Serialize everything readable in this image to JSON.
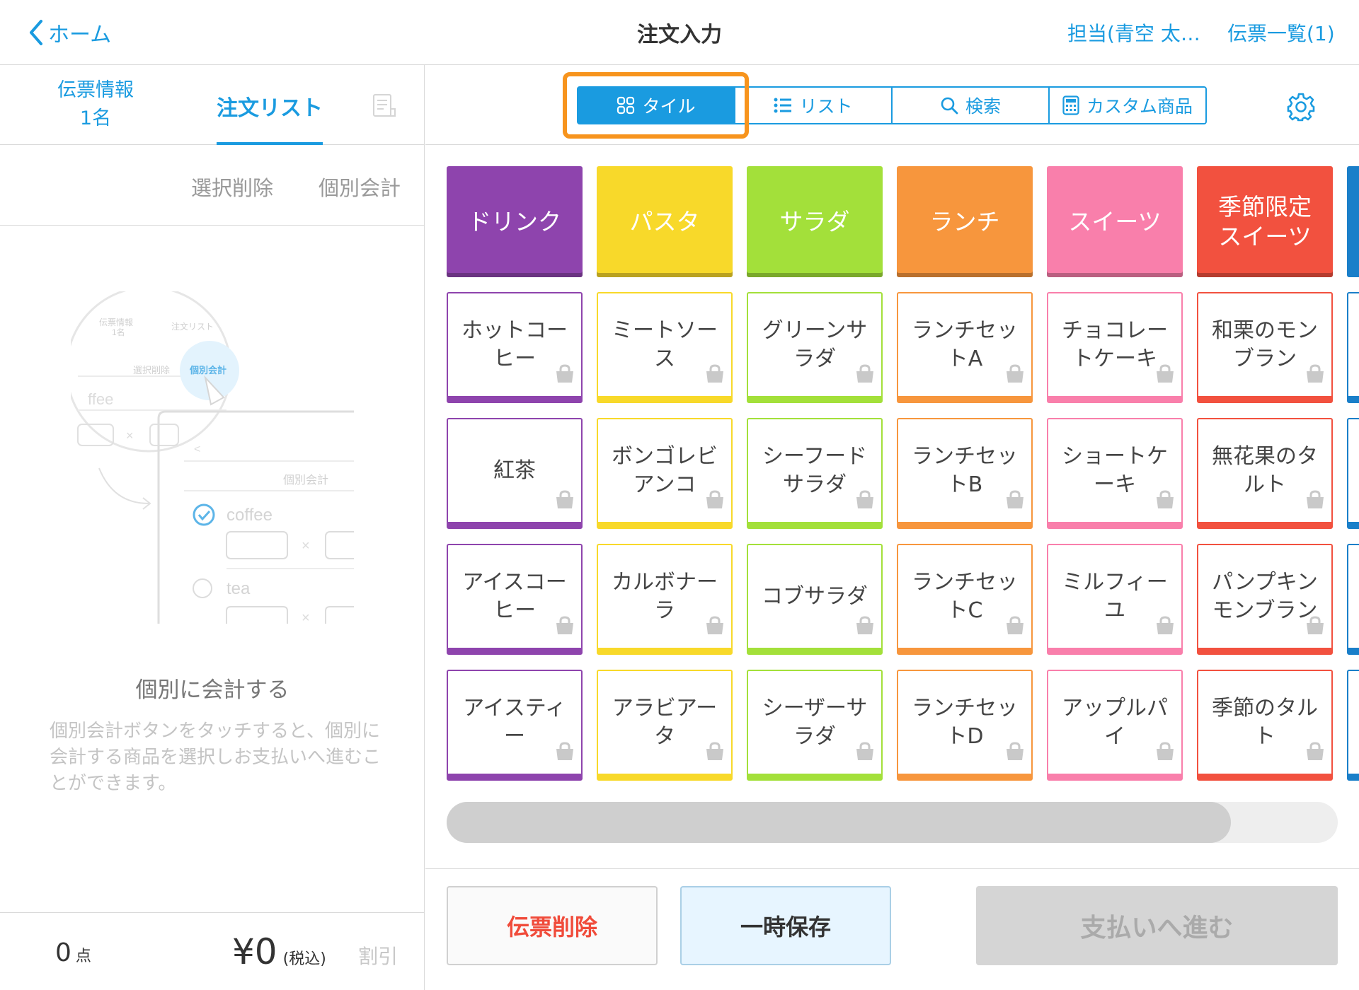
{
  "header": {
    "back_label": "ホーム",
    "title": "注文入力",
    "staff": "担当(青空 太…",
    "slip_list": "伝票一覧(1)"
  },
  "left": {
    "tab_info_line1": "伝票情報",
    "tab_info_line2": "1名",
    "tab_order": "注文リスト",
    "action_delete": "選択削除",
    "action_split": "個別会計",
    "illus": {
      "info": "伝票情報",
      "people": "1名",
      "order": "注文リスト",
      "del": "選択削除",
      "split": "個別会計",
      "ffee": "ffee",
      "coffee": "coffee",
      "tea": "tea",
      "x": "×",
      "lt": "<"
    },
    "empty_title": "個別に会計する",
    "empty_desc": "個別会計ボタンをタッチすると、個別に会計する商品を選択しお支払いへ進むことができます。",
    "count": "0",
    "count_unit": "点",
    "total": "¥0",
    "total_tax": "(税込)",
    "discount": "割引"
  },
  "view_modes": [
    "タイル",
    "リスト",
    "検索",
    "カスタム商品"
  ],
  "categories": [
    {
      "label": "ドリンク",
      "color": "#8e44ad"
    },
    {
      "label": "パスタ",
      "color": "#f8d92a"
    },
    {
      "label": "サラダ",
      "color": "#a3e03a"
    },
    {
      "label": "ランチ",
      "color": "#f7963d"
    },
    {
      "label": "スイーツ",
      "color": "#f97fab"
    },
    {
      "label": "季節限定スイーツ",
      "color": "#f2513f"
    }
  ],
  "products": [
    [
      "ホットコーヒー",
      "紅茶",
      "アイスコーヒー",
      "アイスティー"
    ],
    [
      "ミートソース",
      "ボンゴレビアンコ",
      "カルボナーラ",
      "アラビアータ"
    ],
    [
      "グリーンサラダ",
      "シーフードサラダ",
      "コブサラダ",
      "シーザーサラダ"
    ],
    [
      "ランチセットA",
      "ランチセットB",
      "ランチセットC",
      "ランチセットD"
    ],
    [
      "チョコレートケーキ",
      "ショートケーキ",
      "ミルフィーユ",
      "アップルパイ"
    ],
    [
      "和栗のモンブラン",
      "無花果のタルト",
      "パンプキンモンブラン",
      "季節のタルト"
    ]
  ],
  "next_category_color": "#1a7fc9",
  "scroll_position": 0.88,
  "buttons": {
    "delete": "伝票削除",
    "hold": "一時保存",
    "pay": "支払いへ進む"
  }
}
